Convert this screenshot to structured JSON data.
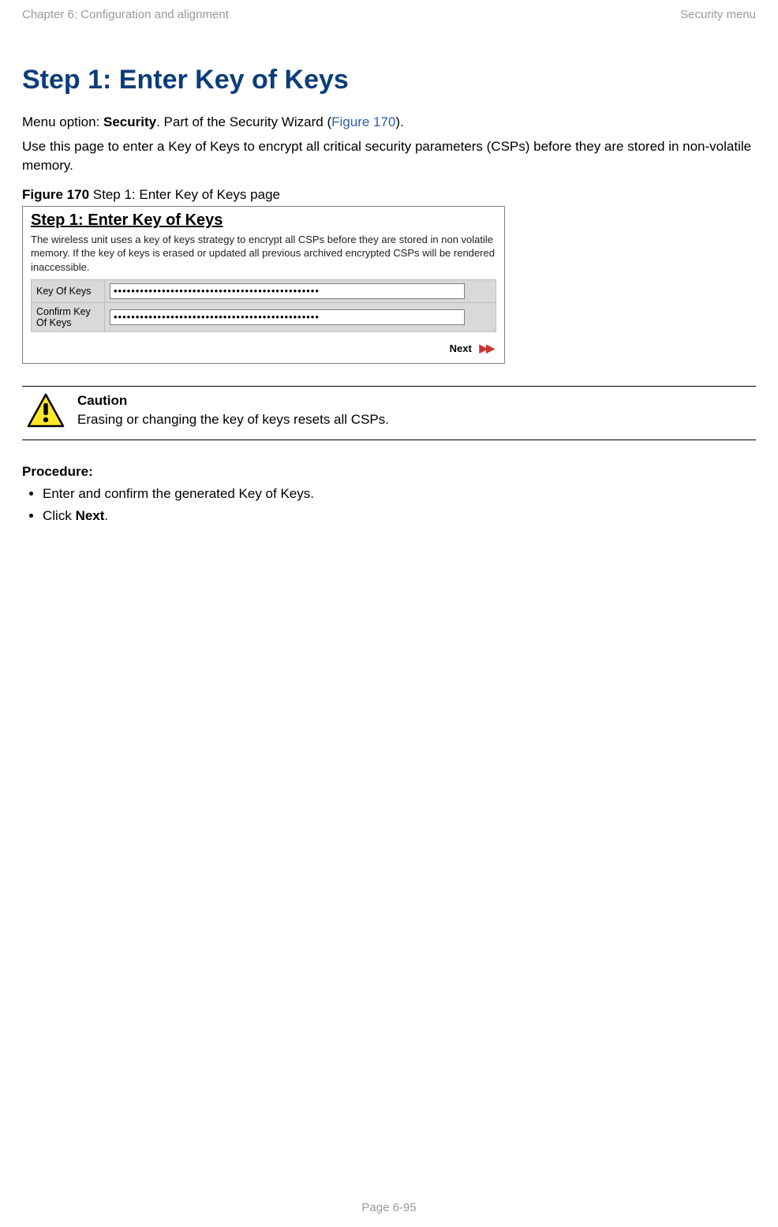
{
  "header": {
    "left": "Chapter 6:  Configuration and alignment",
    "right": "Security menu"
  },
  "section_title": "Step 1: Enter Key of Keys",
  "intro": {
    "prefix": "Menu option: ",
    "menu_option": "Security",
    "mid": ". Part of the Security Wizard (",
    "figure_ref": "Figure 170",
    "suffix": ")."
  },
  "intro_para2": "Use this page to enter a Key of Keys to encrypt all critical security parameters (CSPs) before they are stored in non-volatile memory.",
  "figure_caption": {
    "label": "Figure 170",
    "text": "  Step 1: Enter Key of Keys page"
  },
  "screenshot": {
    "title": "Step 1: Enter Key of Keys",
    "description": "The wireless unit uses a key of keys strategy to encrypt all CSPs before they are stored in non volatile memory. If the key of keys is erased or updated all previous archived encrypted CSPs will be rendered inaccessible.",
    "rows": [
      {
        "label": "Key Of Keys",
        "value": "•••••••••••••••••••••••••••••••••••••••••••••••"
      },
      {
        "label": "Confirm Key Of Keys",
        "value": "•••••••••••••••••••••••••••••••••••••••••••••••"
      }
    ],
    "next_label": "Next"
  },
  "caution": {
    "title": "Caution",
    "body": "Erasing or changing the key of keys resets all CSPs."
  },
  "procedure": {
    "heading": "Procedure:",
    "items": [
      {
        "text": "Enter and confirm the generated Key of Keys."
      },
      {
        "prefix": "Click ",
        "bold": "Next",
        "suffix": "."
      }
    ]
  },
  "footer": "Page 6-95"
}
